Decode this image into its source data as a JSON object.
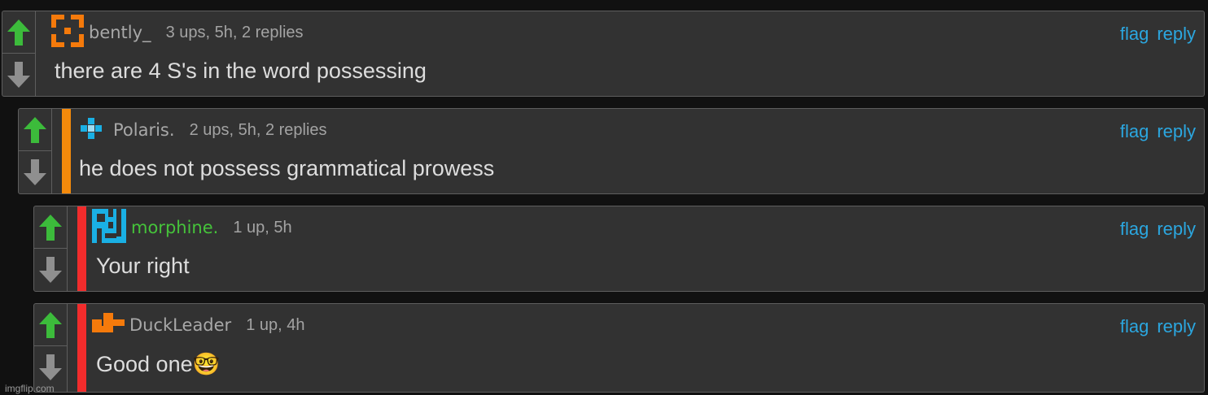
{
  "colors": {
    "background": "#111111",
    "panel": "#323232",
    "upvote": "#3cbb3b",
    "downvote": "#8f8f8f",
    "link": "#2ba7e0",
    "depth_bar_level1": "#f58a0b",
    "depth_bar_level2": "#f22c2c",
    "mod_username": "#45c33a"
  },
  "actions": {
    "flag_label": "flag",
    "reply_label": "reply"
  },
  "comments": [
    {
      "username": "bently_",
      "stats": "3 ups, 5h, 2 replies",
      "text": "there are 4 S's in the word possessing",
      "avatar_icon": "orange-square-avatar-icon",
      "depth": 0
    },
    {
      "username": "Polaris.",
      "stats": "2 ups, 5h, 2 replies",
      "text": "he does not possess grammatical prowess",
      "avatar_icon": "blue-cross-avatar-icon",
      "depth": 1
    },
    {
      "username": "morphine.",
      "stats": "1 up, 5h",
      "text": "Your right",
      "avatar_icon": "blue-glyph-avatar-icon",
      "depth": 2
    },
    {
      "username": "DuckLeader",
      "stats": "1 up, 4h",
      "text": "Good one🤓",
      "avatar_icon": "orange-duck-avatar-icon",
      "depth": 2
    }
  ],
  "watermark": "imgflip.com"
}
